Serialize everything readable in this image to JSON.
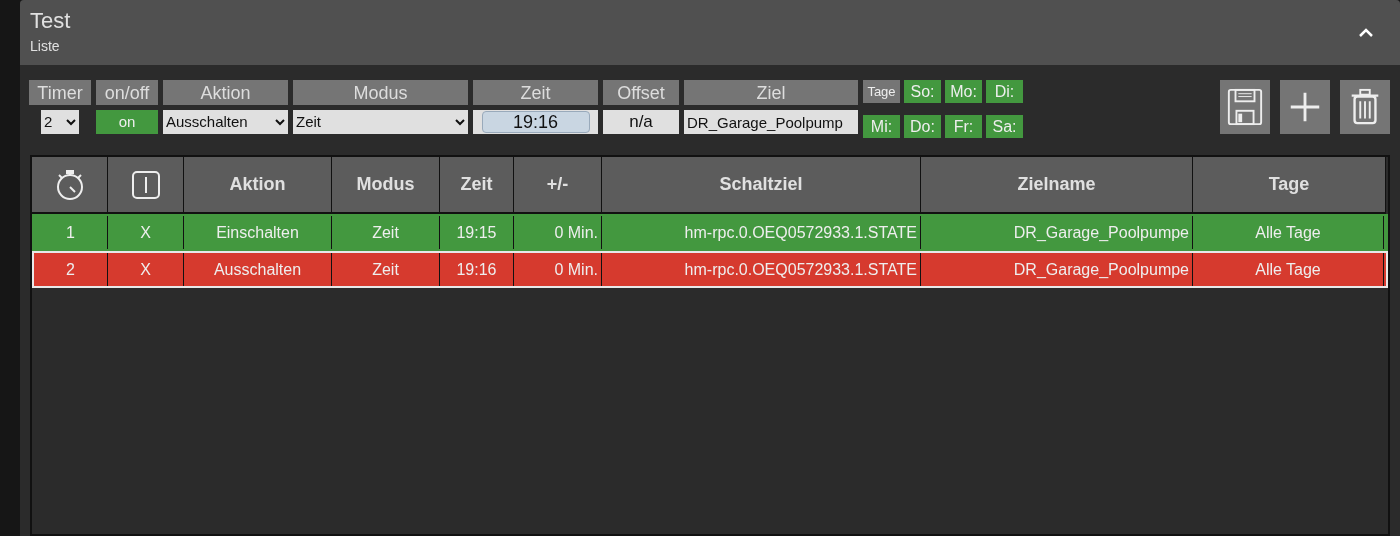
{
  "panel": {
    "title": "Test",
    "subtitle": "Liste",
    "expanded": true
  },
  "form": {
    "fields": [
      {
        "label": "Timer",
        "kind": "select",
        "value": "2"
      },
      {
        "label": "on/off",
        "kind": "toggle",
        "value": "on",
        "on": true
      },
      {
        "label": "Aktion",
        "kind": "select",
        "value": "Ausschalten"
      },
      {
        "label": "Modus",
        "kind": "select",
        "value": "Zeit"
      },
      {
        "label": "Zeit",
        "kind": "time",
        "value": "19:16"
      },
      {
        "label": "Offset",
        "kind": "readonly",
        "value": "n/a"
      },
      {
        "label": "Ziel",
        "kind": "text",
        "value": "DR_Garage_Poolpump"
      }
    ],
    "days_label": "Tage",
    "days": [
      {
        "label": "So:",
        "on": true
      },
      {
        "label": "Mo:",
        "on": true
      },
      {
        "label": "Di:",
        "on": true
      },
      {
        "label": "Mi:",
        "on": true
      },
      {
        "label": "Do:",
        "on": true
      },
      {
        "label": "Fr:",
        "on": true
      },
      {
        "label": "Sa:",
        "on": true
      }
    ]
  },
  "table": {
    "columns": [
      {
        "kind": "stopwatch-icon"
      },
      {
        "kind": "switch-icon"
      },
      {
        "label": "Aktion"
      },
      {
        "label": "Modus"
      },
      {
        "label": "Zeit"
      },
      {
        "label": "+/-"
      },
      {
        "label": "Schaltziel"
      },
      {
        "label": "Zielname"
      },
      {
        "label": "Tage"
      }
    ],
    "rows": [
      {
        "cells": [
          "1",
          "X",
          "Einschalten",
          "Zeit",
          "19:15",
          "0 Min.",
          "hm-rpc.0.OEQ0572933.1.STATE",
          "DR_Garage_Poolpumpe",
          "Alle Tage"
        ],
        "color": "#43983f",
        "selected": false
      },
      {
        "cells": [
          "2",
          "X",
          "Ausschalten",
          "Zeit",
          "19:16",
          "0 Min.",
          "hm-rpc.0.OEQ0572933.1.STATE",
          "DR_Garage_Poolpumpe",
          "Alle Tage"
        ],
        "color": "#d63a2e",
        "selected": true
      }
    ]
  }
}
